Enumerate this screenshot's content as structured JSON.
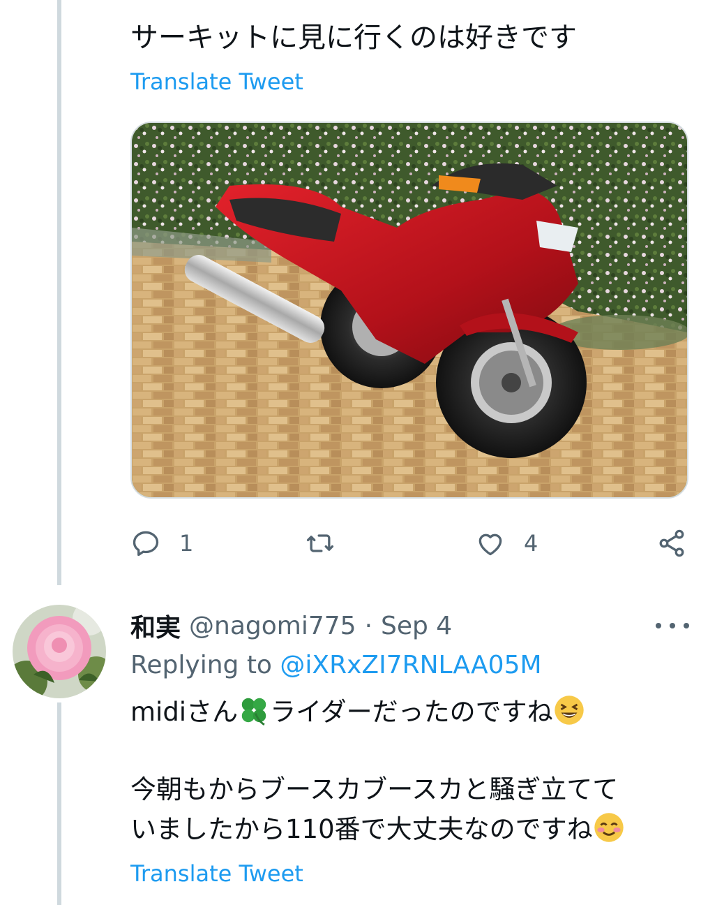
{
  "tweet": {
    "text": "サーキットに見に行くのは好きです",
    "translate_label": "Translate Tweet",
    "stats": {
      "replies": "1",
      "likes": "4"
    }
  },
  "reply": {
    "name": "和実",
    "handle": "@nagomi775",
    "dot": "·",
    "date": "Sep 4",
    "replying_prefix": "Replying to",
    "replying_to": "@iXRxZI7RNLAA05M",
    "line1_a": "midiさん",
    "line1_b": "ライダーだったのですね",
    "line2": "今朝もからブースカブースカと騒ぎ立てて",
    "line3": "いましたから110番で大丈夫なのですね",
    "translate_label": "Translate Tweet"
  },
  "icons": [
    "reply-icon",
    "retweet-icon",
    "like-icon",
    "share-icon",
    "more-icon",
    "clover-emoji",
    "laughing-emoji",
    "smiling-blush-emoji"
  ],
  "colors": {
    "link": "#1d9bf0",
    "muted": "#536471",
    "text": "#0f1419",
    "thread_line": "#cfd9de"
  }
}
